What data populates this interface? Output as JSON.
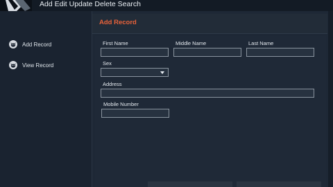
{
  "window": {
    "title": "Add Edit Update Delete Search"
  },
  "sidebar": {
    "items": [
      {
        "label": "Add Record",
        "icon": "cat-icon"
      },
      {
        "label": "View Record",
        "icon": "cat-icon"
      }
    ]
  },
  "main": {
    "header_title": "Add Record",
    "accent_color": "#e8623a"
  },
  "form": {
    "first_name": {
      "label": "First Name",
      "value": ""
    },
    "middle_name": {
      "label": "Middle Name",
      "value": ""
    },
    "last_name": {
      "label": "Last Name",
      "value": ""
    },
    "sex": {
      "label": "Sex",
      "value": ""
    },
    "address": {
      "label": "Address",
      "value": ""
    },
    "mobile_number": {
      "label": "Mobile Number",
      "value": ""
    }
  }
}
